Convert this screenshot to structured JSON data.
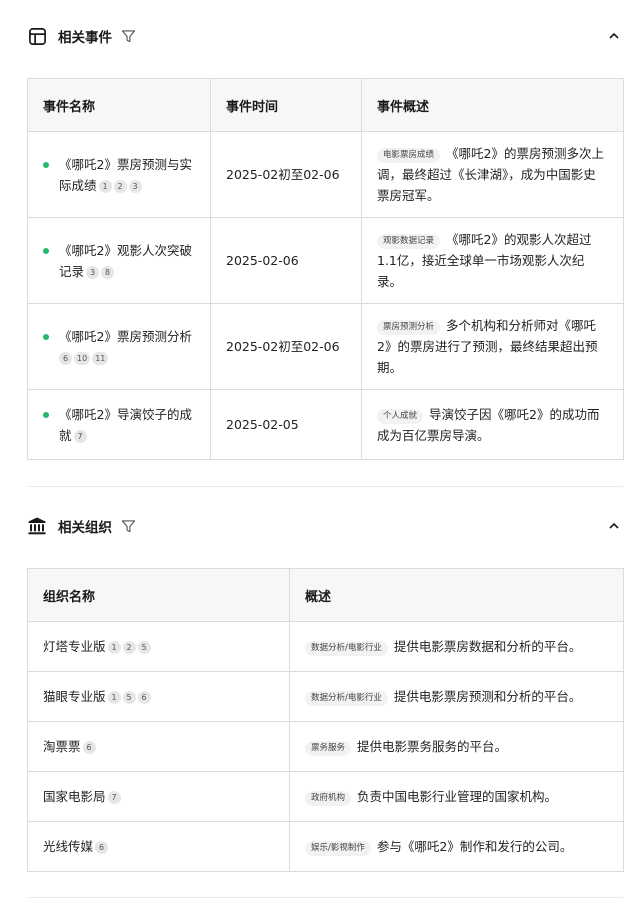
{
  "events_section": {
    "title": "相关事件",
    "columns": [
      "事件名称",
      "事件时间",
      "事件概述"
    ],
    "rows": [
      {
        "name_l1": "《哪吒2》票房预测与实",
        "name_l2": "际成绩",
        "refs": [
          "1",
          "2",
          "3"
        ],
        "time": "2025-02初至02-06",
        "tag": "电影票房成绩",
        "desc": "《哪吒2》的票房预测多次上调，最终超过《长津湖》，成为中国影史票房冠军。"
      },
      {
        "name_l1": "《哪吒2》观影人次突破",
        "name_l2": "记录",
        "refs": [
          "3",
          "8"
        ],
        "time": "2025-02-06",
        "tag": "观影数据记录",
        "desc": "《哪吒2》的观影人次超过1.1亿，接近全球单一市场观影人次纪录。"
      },
      {
        "name_l1": "《哪吒2》票房预测分析",
        "name_l2": "",
        "refs": [
          "6",
          "10",
          "11"
        ],
        "time": "2025-02初至02-06",
        "tag": "票房预测分析",
        "desc": "多个机构和分析师对《哪吒2》的票房进行了预测，最终结果超出预期。"
      },
      {
        "name_l1": "《哪吒2》导演饺子的成",
        "name_l2": "就",
        "refs": [
          "7"
        ],
        "time": "2025-02-05",
        "tag": "个人成就",
        "desc": "导演饺子因《哪吒2》的成功而成为百亿票房导演。"
      }
    ]
  },
  "orgs_section": {
    "title": "相关组织",
    "columns": [
      "组织名称",
      "概述"
    ],
    "rows": [
      {
        "name": "灯塔专业版",
        "refs": [
          "1",
          "2",
          "5"
        ],
        "tag": "数据分析/电影行业",
        "desc": "提供电影票房数据和分析的平台。"
      },
      {
        "name": "猫眼专业版",
        "refs": [
          "1",
          "5",
          "6"
        ],
        "tag": "数据分析/电影行业",
        "desc": "提供电影票房预测和分析的平台。"
      },
      {
        "name": "淘票票",
        "refs": [
          "6"
        ],
        "tag": "票务服务",
        "desc": "提供电影票务服务的平台。"
      },
      {
        "name": "国家电影局",
        "refs": [
          "7"
        ],
        "tag": "政府机构",
        "desc": "负责中国电影行业管理的国家机构。"
      },
      {
        "name": "光线传媒",
        "refs": [
          "6"
        ],
        "tag": "娱乐/影视制作",
        "desc": "参与《哪吒2》制作和发行的公司。"
      }
    ]
  },
  "icons": {
    "events": "table-layout-icon",
    "orgs": "institution-building-icon",
    "filter": "filter-funnel-icon",
    "collapse": "chevron-up-icon"
  },
  "colors": {
    "dot": "#22b96a",
    "header_bg": "#f7f7f7",
    "border": "#dcdcdc",
    "tag_bg": "#f1f2f4",
    "badge_bg": "#e6e6e6"
  }
}
